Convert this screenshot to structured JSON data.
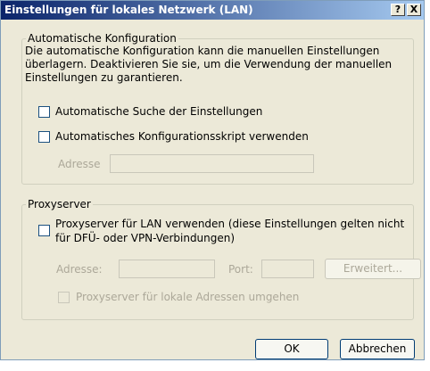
{
  "window": {
    "title": "Einstellungen für lokales Netzwerk (LAN)",
    "help_glyph": "?",
    "close_glyph": "X"
  },
  "auto_config": {
    "group_label": "Automatische Konfiguration",
    "description": "Die automatische Konfiguration kann die manuellen Einstellungen überlagern. Deaktivieren Sie sie, um die Verwendung der manuellen Einstellungen zu garantieren.",
    "auto_detect_label": "Automatische Suche der Einstellungen",
    "auto_script_label": "Automatisches Konfigurationsskript verwenden",
    "address_label": "Adresse",
    "address_value": ""
  },
  "proxy": {
    "group_label": "Proxyserver",
    "use_proxy_line1": "Proxyserver für LAN verwenden (diese Einstellungen gelten nicht",
    "use_proxy_line2": "für DFÜ- oder VPN-Verbindungen)",
    "address_label": "Adresse:",
    "address_value": "",
    "port_label": "Port:",
    "port_value": "",
    "advanced_button": "Erweitert...",
    "bypass_label": "Proxyserver für lokale Adressen umgehen"
  },
  "buttons": {
    "ok": "OK",
    "cancel": "Abbrechen"
  }
}
